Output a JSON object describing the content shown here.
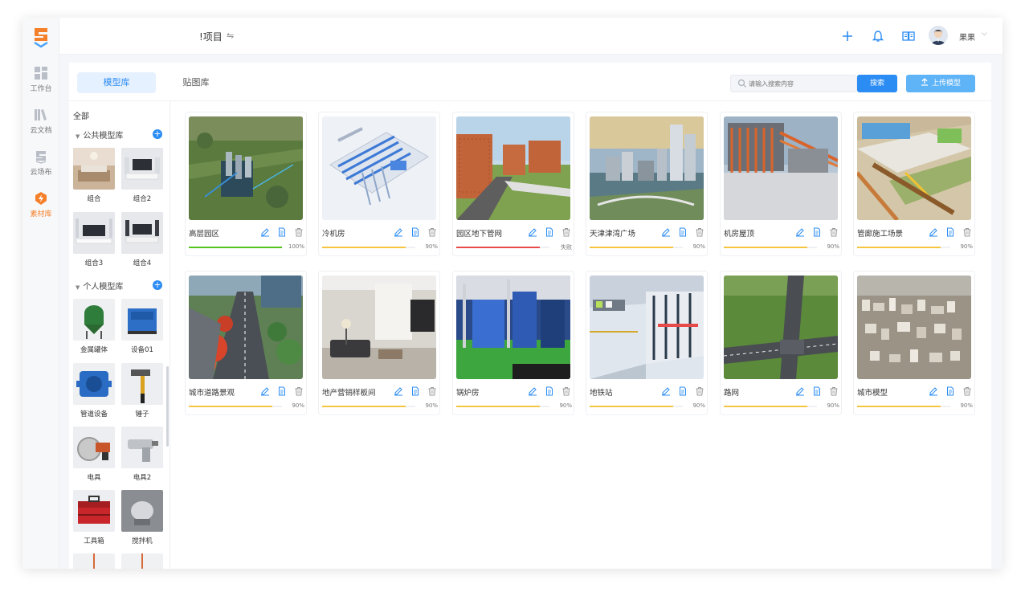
{
  "rail": {
    "items": [
      {
        "label": "工作台",
        "icon": "grid-icon"
      },
      {
        "label": "云文档",
        "icon": "books-icon"
      },
      {
        "label": "云场布",
        "icon": "site-icon"
      },
      {
        "label": "素材库",
        "icon": "lightning-icon"
      }
    ]
  },
  "header": {
    "project": "!项目",
    "user": "果果"
  },
  "tabs": {
    "model_lib": "模型库",
    "texture_lib": "贴图库"
  },
  "search": {
    "placeholder": "请输入搜索内容",
    "button": "搜索"
  },
  "upload": "上传模型",
  "library": {
    "all": "全部",
    "public_title": "公共模型库",
    "public_items": [
      "组合",
      "组合2",
      "组合3",
      "组合4"
    ],
    "personal_title": "个人模型库",
    "personal_items": [
      "金属罐体",
      "设备01",
      "管道设备",
      "锤子",
      "电具",
      "电具2",
      "工具箱",
      "搅拌机"
    ]
  },
  "models": [
    {
      "name": "高层园区",
      "status": "100%",
      "progress": 1.0
    },
    {
      "name": "冷机房",
      "status": "90%",
      "progress": 0.9
    },
    {
      "name": "园区地下管网",
      "status": "失败",
      "progress": 0.9
    },
    {
      "name": "天津津湾广场",
      "status": "90%",
      "progress": 0.9
    },
    {
      "name": "机房屋顶",
      "status": "90%",
      "progress": 0.9
    },
    {
      "name": "管廊施工场景",
      "status": "90%",
      "progress": 0.9
    },
    {
      "name": "城市道路景观",
      "status": "90%",
      "progress": 0.9
    },
    {
      "name": "地产营销样板间",
      "status": "90%",
      "progress": 0.9
    },
    {
      "name": "锅炉房",
      "status": "90%",
      "progress": 0.9
    },
    {
      "name": "地铁站",
      "status": "90%",
      "progress": 0.9
    },
    {
      "name": "路网",
      "status": "90%",
      "progress": 0.9
    },
    {
      "name": "城市模型",
      "status": "90%",
      "progress": 0.9
    }
  ],
  "colors": {
    "accent": "#2b8cf3",
    "progress_done": "#52c41a",
    "progress_mid": "#f5c542",
    "progress_fail": "#e84a4a",
    "brand": "#f5802a"
  }
}
